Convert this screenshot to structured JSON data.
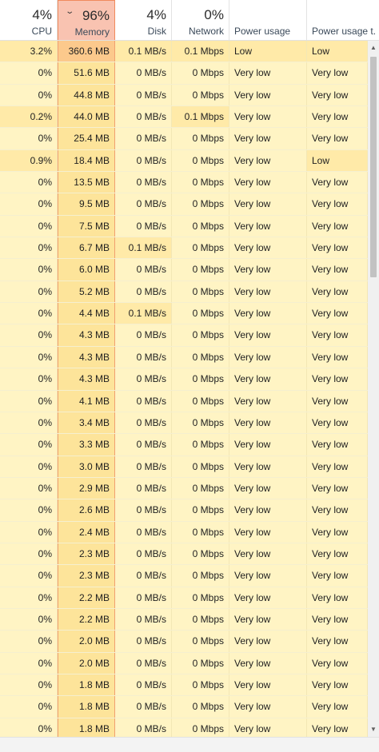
{
  "header": {
    "cpu": {
      "pct": "4%",
      "label": "CPU"
    },
    "memory": {
      "pct": "96%",
      "label": "Memory",
      "sort_icon": "chevron-down-icon"
    },
    "disk": {
      "pct": "4%",
      "label": "Disk"
    },
    "network": {
      "pct": "0%",
      "label": "Network"
    },
    "power": {
      "label": "Power usage"
    },
    "power_trend": {
      "label": "Power usage t..."
    }
  },
  "colors": {
    "cell_bg": "#fff4c4",
    "cell_highlight": "#ffeaa8",
    "memory_col": "#fde49a",
    "memory_top": "#fcc98c",
    "sorted_header": "#f9c3b1",
    "sorted_border": "#f08a5d"
  },
  "rows": [
    {
      "cpu": "3.2%",
      "mem": "360.6 MB",
      "disk": "0.1 MB/s",
      "net": "0.1 Mbps",
      "power": "Low",
      "trend": "Low",
      "hi": [
        "cpu",
        "disk",
        "net",
        "power",
        "trend"
      ]
    },
    {
      "cpu": "0%",
      "mem": "51.6 MB",
      "disk": "0 MB/s",
      "net": "0 Mbps",
      "power": "Very low",
      "trend": "Very low",
      "hi": []
    },
    {
      "cpu": "0%",
      "mem": "44.8 MB",
      "disk": "0 MB/s",
      "net": "0 Mbps",
      "power": "Very low",
      "trend": "Very low",
      "hi": []
    },
    {
      "cpu": "0.2%",
      "mem": "44.0 MB",
      "disk": "0 MB/s",
      "net": "0.1 Mbps",
      "power": "Very low",
      "trend": "Very low",
      "hi": [
        "cpu",
        "net"
      ]
    },
    {
      "cpu": "0%",
      "mem": "25.4 MB",
      "disk": "0 MB/s",
      "net": "0 Mbps",
      "power": "Very low",
      "trend": "Very low",
      "hi": []
    },
    {
      "cpu": "0.9%",
      "mem": "18.4 MB",
      "disk": "0 MB/s",
      "net": "0 Mbps",
      "power": "Very low",
      "trend": "Low",
      "hi": [
        "cpu",
        "trend"
      ]
    },
    {
      "cpu": "0%",
      "mem": "13.5 MB",
      "disk": "0 MB/s",
      "net": "0 Mbps",
      "power": "Very low",
      "trend": "Very low",
      "hi": []
    },
    {
      "cpu": "0%",
      "mem": "9.5 MB",
      "disk": "0 MB/s",
      "net": "0 Mbps",
      "power": "Very low",
      "trend": "Very low",
      "hi": []
    },
    {
      "cpu": "0%",
      "mem": "7.5 MB",
      "disk": "0 MB/s",
      "net": "0 Mbps",
      "power": "Very low",
      "trend": "Very low",
      "hi": []
    },
    {
      "cpu": "0%",
      "mem": "6.7 MB",
      "disk": "0.1 MB/s",
      "net": "0 Mbps",
      "power": "Very low",
      "trend": "Very low",
      "hi": [
        "disk"
      ]
    },
    {
      "cpu": "0%",
      "mem": "6.0 MB",
      "disk": "0 MB/s",
      "net": "0 Mbps",
      "power": "Very low",
      "trend": "Very low",
      "hi": []
    },
    {
      "cpu": "0%",
      "mem": "5.2 MB",
      "disk": "0 MB/s",
      "net": "0 Mbps",
      "power": "Very low",
      "trend": "Very low",
      "hi": []
    },
    {
      "cpu": "0%",
      "mem": "4.4 MB",
      "disk": "0.1 MB/s",
      "net": "0 Mbps",
      "power": "Very low",
      "trend": "Very low",
      "hi": [
        "disk"
      ]
    },
    {
      "cpu": "0%",
      "mem": "4.3 MB",
      "disk": "0 MB/s",
      "net": "0 Mbps",
      "power": "Very low",
      "trend": "Very low",
      "hi": []
    },
    {
      "cpu": "0%",
      "mem": "4.3 MB",
      "disk": "0 MB/s",
      "net": "0 Mbps",
      "power": "Very low",
      "trend": "Very low",
      "hi": []
    },
    {
      "cpu": "0%",
      "mem": "4.3 MB",
      "disk": "0 MB/s",
      "net": "0 Mbps",
      "power": "Very low",
      "trend": "Very low",
      "hi": []
    },
    {
      "cpu": "0%",
      "mem": "4.1 MB",
      "disk": "0 MB/s",
      "net": "0 Mbps",
      "power": "Very low",
      "trend": "Very low",
      "hi": []
    },
    {
      "cpu": "0%",
      "mem": "3.4 MB",
      "disk": "0 MB/s",
      "net": "0 Mbps",
      "power": "Very low",
      "trend": "Very low",
      "hi": []
    },
    {
      "cpu": "0%",
      "mem": "3.3 MB",
      "disk": "0 MB/s",
      "net": "0 Mbps",
      "power": "Very low",
      "trend": "Very low",
      "hi": []
    },
    {
      "cpu": "0%",
      "mem": "3.0 MB",
      "disk": "0 MB/s",
      "net": "0 Mbps",
      "power": "Very low",
      "trend": "Very low",
      "hi": []
    },
    {
      "cpu": "0%",
      "mem": "2.9 MB",
      "disk": "0 MB/s",
      "net": "0 Mbps",
      "power": "Very low",
      "trend": "Very low",
      "hi": []
    },
    {
      "cpu": "0%",
      "mem": "2.6 MB",
      "disk": "0 MB/s",
      "net": "0 Mbps",
      "power": "Very low",
      "trend": "Very low",
      "hi": []
    },
    {
      "cpu": "0%",
      "mem": "2.4 MB",
      "disk": "0 MB/s",
      "net": "0 Mbps",
      "power": "Very low",
      "trend": "Very low",
      "hi": []
    },
    {
      "cpu": "0%",
      "mem": "2.3 MB",
      "disk": "0 MB/s",
      "net": "0 Mbps",
      "power": "Very low",
      "trend": "Very low",
      "hi": []
    },
    {
      "cpu": "0%",
      "mem": "2.3 MB",
      "disk": "0 MB/s",
      "net": "0 Mbps",
      "power": "Very low",
      "trend": "Very low",
      "hi": []
    },
    {
      "cpu": "0%",
      "mem": "2.2 MB",
      "disk": "0 MB/s",
      "net": "0 Mbps",
      "power": "Very low",
      "trend": "Very low",
      "hi": []
    },
    {
      "cpu": "0%",
      "mem": "2.2 MB",
      "disk": "0 MB/s",
      "net": "0 Mbps",
      "power": "Very low",
      "trend": "Very low",
      "hi": []
    },
    {
      "cpu": "0%",
      "mem": "2.0 MB",
      "disk": "0 MB/s",
      "net": "0 Mbps",
      "power": "Very low",
      "trend": "Very low",
      "hi": []
    },
    {
      "cpu": "0%",
      "mem": "2.0 MB",
      "disk": "0 MB/s",
      "net": "0 Mbps",
      "power": "Very low",
      "trend": "Very low",
      "hi": []
    },
    {
      "cpu": "0%",
      "mem": "1.8 MB",
      "disk": "0 MB/s",
      "net": "0 Mbps",
      "power": "Very low",
      "trend": "Very low",
      "hi": []
    },
    {
      "cpu": "0%",
      "mem": "1.8 MB",
      "disk": "0 MB/s",
      "net": "0 Mbps",
      "power": "Very low",
      "trend": "Very low",
      "hi": []
    },
    {
      "cpu": "0%",
      "mem": "1.8 MB",
      "disk": "0 MB/s",
      "net": "0 Mbps",
      "power": "Very low",
      "trend": "Very low",
      "hi": []
    }
  ]
}
